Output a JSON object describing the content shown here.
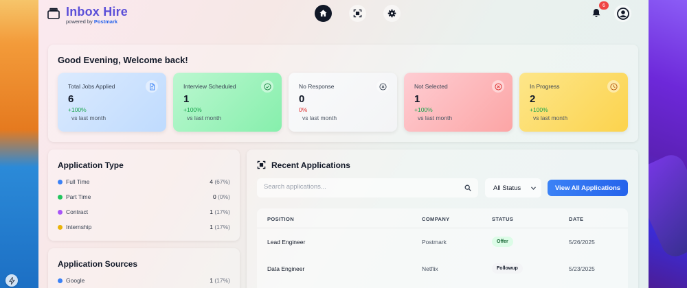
{
  "brand": {
    "title": "Inbox Hire",
    "powered_prefix": "powered by",
    "powered_name": "Postmark"
  },
  "nav": [
    "home-icon",
    "scan-icon",
    "gear-icon"
  ],
  "notifications": {
    "count": "6"
  },
  "welcome": {
    "title": "Good Evening, Welcome back!",
    "stats": [
      {
        "label": "Total Jobs Applied",
        "value": "6",
        "change": "+100%",
        "sub": "vs last month",
        "icon": "document-icon"
      },
      {
        "label": "Interview Scheduled",
        "value": "1",
        "change": "+100%",
        "sub": "vs last month",
        "icon": "check-circle-icon"
      },
      {
        "label": "No Response",
        "value": "0",
        "change": "0%",
        "sub": "vs last month",
        "icon": "x-circle-icon"
      },
      {
        "label": "Not Selected",
        "value": "1",
        "change": "+100%",
        "sub": "vs last month",
        "icon": "x-circle-icon"
      },
      {
        "label": "In Progress",
        "value": "2",
        "change": "+100%",
        "sub": "vs last month",
        "icon": "clock-icon"
      }
    ]
  },
  "application_type": {
    "title": "Application Type",
    "items": [
      {
        "name": "Full Time",
        "count": "4",
        "pct": "(67%)",
        "color": "#3b82f6"
      },
      {
        "name": "Part Time",
        "count": "0",
        "pct": "(0%)",
        "color": "#22c55e"
      },
      {
        "name": "Contract",
        "count": "1",
        "pct": "(17%)",
        "color": "#a855f7"
      },
      {
        "name": "Internship",
        "count": "1",
        "pct": "(17%)",
        "color": "#eab308"
      }
    ]
  },
  "application_sources": {
    "title": "Application Sources",
    "items": [
      {
        "name": "Google",
        "count": "1",
        "pct": "(17%)",
        "color": "#3b82f6"
      }
    ]
  },
  "recent": {
    "title": "Recent Applications",
    "search_placeholder": "Search applications...",
    "status_filter": "All Status",
    "view_all_label": "View All Applications",
    "columns": [
      "POSITION",
      "COMPANY",
      "STATUS",
      "DATE"
    ],
    "rows": [
      {
        "position": "Lead Engineer",
        "company": "Postmark",
        "status": "Offer",
        "date": "5/26/2025"
      },
      {
        "position": "Data Engineer",
        "company": "Netflix",
        "status": "Followup",
        "date": "5/23/2025"
      }
    ]
  }
}
